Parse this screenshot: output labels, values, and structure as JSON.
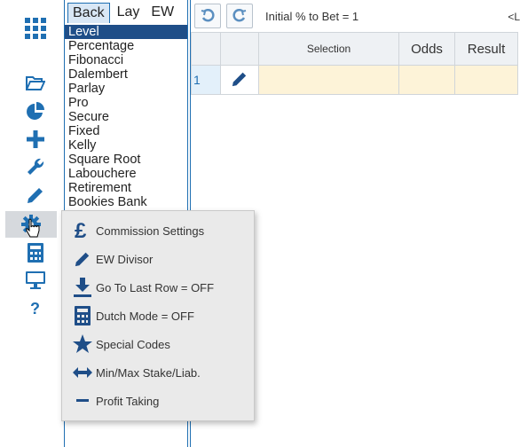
{
  "colors": {
    "brand": "#1f4e88",
    "accent": "#1f6fb2",
    "highlight": "#fdf3d8"
  },
  "toolbar": {
    "icons": [
      "grid-icon",
      "folder-open-icon",
      "pie-chart-icon",
      "plus-icon",
      "wrench-icon",
      "pencil-icon",
      "gear-icon",
      "calculator-icon",
      "monitor-icon",
      "help-icon"
    ]
  },
  "panel": {
    "tabs": [
      "Back",
      "Lay",
      "EW"
    ],
    "items": [
      "Level",
      "Percentage",
      "Fibonacci",
      "Dalembert",
      "Parlay",
      "Pro",
      "Secure",
      "Fixed",
      "Kelly",
      "Square Root",
      "Labouchere",
      "Retirement",
      "Bookies Bank"
    ]
  },
  "main": {
    "initial_text": "Initial % to Bet = 1",
    "cutoff_text": "<L",
    "columns": [
      "",
      "",
      "Selection",
      "Odds",
      "Result"
    ],
    "row_number": "1"
  },
  "menu": {
    "items": [
      "Commission Settings",
      "EW Divisor",
      "Go To Last Row = OFF",
      "Dutch Mode = OFF",
      "Special Codes",
      "Min/Max Stake/Liab.",
      "Profit Taking"
    ]
  }
}
